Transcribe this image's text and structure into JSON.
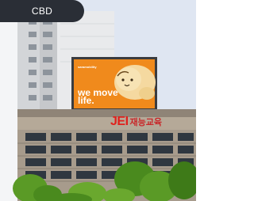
{
  "location_tag": {
    "label": "CBD"
  },
  "billboard": {
    "brand": "saramobility",
    "slogan": "we move life."
  },
  "rooftop_sign": {
    "latin": "JEI",
    "local": "재능교육"
  },
  "colors": {
    "sky": "#dfe6f2",
    "billboard_orange": "#f08a1c",
    "sign_red": "#e0201c",
    "pill_background": "#2a2e36",
    "foliage": "#4a8a1e"
  }
}
